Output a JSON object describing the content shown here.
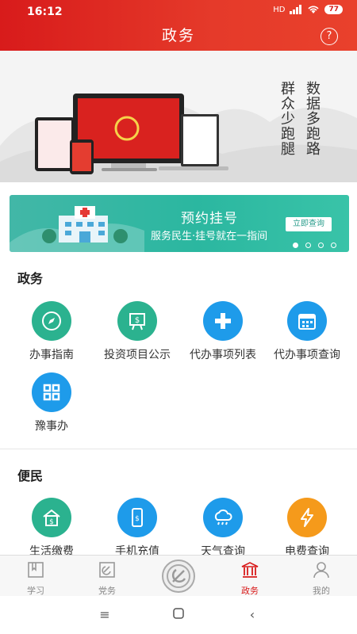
{
  "status_bar": {
    "time": "16:12",
    "network": "HD",
    "battery": "77"
  },
  "header": {
    "title": "政务",
    "help_label": "?"
  },
  "hero": {
    "slogan_col1": "数据多跑路",
    "slogan_col2": "群众少跑腿"
  },
  "banner": {
    "title": "预约挂号",
    "subtitle": "服务民生·挂号就在一指间",
    "button": "立即查询",
    "dots": 4,
    "active_dot": 1
  },
  "sections": {
    "gov": {
      "title": "政务",
      "items": [
        {
          "label": "办事指南",
          "icon": "compass-icon",
          "color": "#2bb28f"
        },
        {
          "label": "投资项目公示",
          "icon": "presentation-board-icon",
          "color": "#2bb28f"
        },
        {
          "label": "代办事项列表",
          "icon": "plus-icon",
          "color": "#1e9bea"
        },
        {
          "label": "代办事项查询",
          "icon": "calendar-icon",
          "color": "#1e9bea"
        },
        {
          "label": "豫事办",
          "icon": "yushiban-logo-icon",
          "color": "#1e9bea"
        }
      ]
    },
    "life": {
      "title": "便民",
      "items": [
        {
          "label": "生活缴费",
          "icon": "house-payment-icon",
          "color": "#2bb28f"
        },
        {
          "label": "手机充值",
          "icon": "phone-recharge-icon",
          "color": "#1e9bea"
        },
        {
          "label": "天气查询",
          "icon": "weather-cloud-icon",
          "color": "#1e9bea"
        },
        {
          "label": "电费查询",
          "icon": "lightning-icon",
          "color": "#f59a1b"
        }
      ]
    }
  },
  "tabs": [
    {
      "label": "学习",
      "icon": "book-icon"
    },
    {
      "label": "党务",
      "icon": "party-flag-icon"
    },
    {
      "label": "",
      "icon": "party-emblem-icon"
    },
    {
      "label": "政务",
      "icon": "government-building-icon",
      "active": true
    },
    {
      "label": "我的",
      "icon": "user-icon"
    }
  ],
  "colors": {
    "brand_red": "#d81b1b",
    "teal": "#2bb28f",
    "blue": "#1e9bea",
    "orange": "#f59a1b"
  }
}
